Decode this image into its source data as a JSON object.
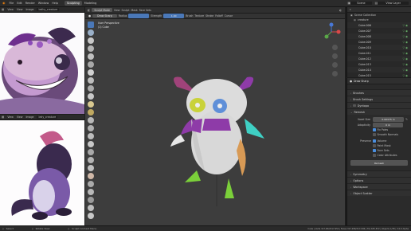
{
  "topbar": {
    "menus": [
      "File",
      "Edit",
      "Render",
      "Window",
      "Help"
    ],
    "tabs": [
      "Sculpting",
      "Modeling"
    ],
    "active_tab": "Sculpting",
    "scene_label": "Scene",
    "view_layer_label": "View Layer"
  },
  "ref_top": {
    "menus": [
      "View",
      "View",
      "Image"
    ],
    "image_name": "ledhy_creature"
  },
  "ref_bottom": {
    "menus": [
      "View",
      "View",
      "Image"
    ],
    "image_name": "ledy_creature"
  },
  "viewport": {
    "mode_label": "Sculpt Mode",
    "menus": [
      "View",
      "Sculpt",
      "Mask",
      "Face Sets"
    ],
    "brush_name": "Draw Sharp",
    "radius_label": "Radius",
    "strength_label": "Strength",
    "strength_value": "1.00",
    "header_dropdowns": [
      "Brush",
      "Texture",
      "Stroke",
      "Falloff",
      "Cursor"
    ],
    "overlay_title": "User Perspective",
    "overlay_object": "(1) Cube"
  },
  "outliner": {
    "title": "Scene Collection",
    "collection": "creature",
    "items": [
      "Cube.006",
      "Cube.007",
      "Cube.008",
      "Cube.009",
      "Cube.010",
      "Cube.011",
      "Cube.012",
      "Cube.013",
      "Cube.014",
      "Cube.015"
    ]
  },
  "properties": {
    "brush_name": "Draw Sharp",
    "sections": {
      "brushes": "Brushes",
      "brush_settings": "Brush Settings",
      "dyntopo": "Dyntopo",
      "remesh": "Remesh",
      "symmetry": "Symmetry",
      "options": "Options",
      "workspace": "Workspace",
      "object_scatter": "Object Scatter"
    },
    "voxel_size_label": "Voxel Size",
    "voxel_size_value": "0.00375 m",
    "adaptivity_label": "Adaptivity",
    "adaptivity_value": "0 m",
    "checks": [
      {
        "label": "Fix Poles",
        "on": true
      },
      {
        "label": "Smooth Normals",
        "on": false
      }
    ],
    "preserve_label": "Preserve",
    "preserve": [
      {
        "label": "Volume",
        "on": true
      },
      {
        "label": "Paint Mask",
        "on": false
      },
      {
        "label": "Face Sets",
        "on": true
      },
      {
        "label": "Color Attributes",
        "on": false
      }
    ],
    "remesh_button": "Remesh"
  },
  "status": {
    "select": "Select",
    "rotate": "Rotate View",
    "context": "Sculpt Context Menu",
    "stats": "Cube | Verts 317,952/317,952 | Faces 317,936/317,936 | Tris 635,872 | Objects 1/38 | 3.0.0 Alpha"
  },
  "colors": {
    "accent": "#4a8fe0",
    "viewport_bg": "#3d3d3d",
    "creature_body": "#e0e0e0",
    "creature_purple": "#8e3ba8",
    "creature_yellow": "#c9d23a",
    "creature_cyan": "#3fd0c4",
    "creature_green": "#7bd03a",
    "creature_orange": "#d89a55"
  }
}
